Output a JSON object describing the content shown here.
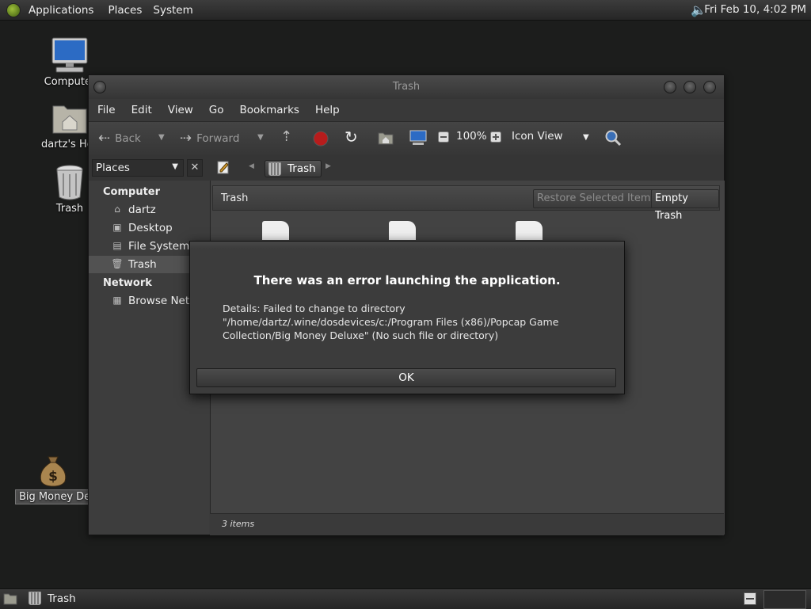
{
  "top_panel": {
    "menus": [
      "Applications",
      "Places",
      "System"
    ],
    "clock": "Fri Feb 10,  4:02 PM"
  },
  "desktop": {
    "icons": [
      {
        "label": "Computer"
      },
      {
        "label": "dartz's Home"
      },
      {
        "label": "Trash"
      },
      {
        "label": "Big Money Deluxe"
      }
    ]
  },
  "window": {
    "title": "Trash",
    "menubar": [
      "File",
      "Edit",
      "View",
      "Go",
      "Bookmarks",
      "Help"
    ],
    "toolbar": {
      "back": "Back",
      "forward": "Forward",
      "zoom": "100%",
      "view_mode": "Icon View"
    },
    "pathbar": {
      "places_combo": "Places",
      "close": "✕",
      "crumb": "Trash"
    },
    "sidebar": {
      "computer_header": "Computer",
      "computer_items": [
        "dartz",
        "Desktop",
        "File System",
        "Trash"
      ],
      "network_header": "Network",
      "network_items": [
        "Browse Net..."
      ]
    },
    "content": {
      "location": "Trash",
      "restore_button": "Restore Selected Items",
      "empty_button": "Empty Trash"
    },
    "status": "3 items"
  },
  "dialog": {
    "title": "There was an error launching the application.",
    "details": "Details: Failed to change to directory \"/home/dartz/.wine/dosdevices/c:/Program Files (x86)/Popcap Game Collection/Big Money Deluxe\" (No such file or directory)",
    "ok": "OK"
  },
  "bottom_panel": {
    "task": "Trash"
  },
  "colors": {
    "desktop_bg": "#1c1d1c",
    "window_bg": "#3b3b3b",
    "selected_item": "#525252"
  }
}
